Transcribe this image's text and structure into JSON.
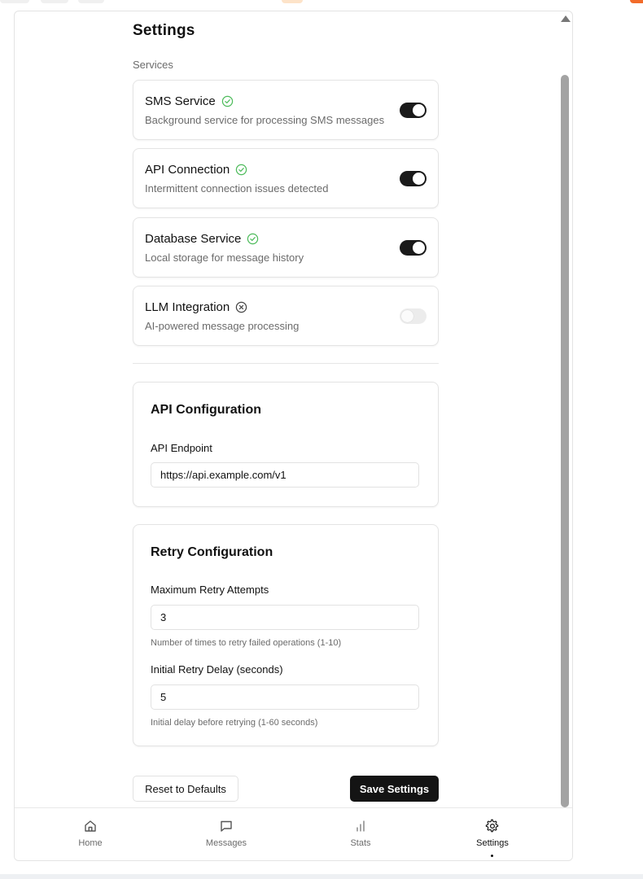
{
  "page": {
    "title": "Settings"
  },
  "services": {
    "label": "Services",
    "items": [
      {
        "name": "SMS Service",
        "description": "Background service for processing SMS messages",
        "status": "ok",
        "enabled": true
      },
      {
        "name": "API Connection",
        "description": "Intermittent connection issues detected",
        "status": "ok",
        "enabled": true
      },
      {
        "name": "Database Service",
        "description": "Local storage for message history",
        "status": "ok",
        "enabled": true
      },
      {
        "name": "LLM Integration",
        "description": "AI-powered message processing",
        "status": "error",
        "enabled": false
      }
    ]
  },
  "api_config": {
    "title": "API Configuration",
    "endpoint_label": "API Endpoint",
    "endpoint_value": "https://api.example.com/v1"
  },
  "retry_config": {
    "title": "Retry Configuration",
    "max_label": "Maximum Retry Attempts",
    "max_value": "3",
    "max_help": "Number of times to retry failed operations (1-10)",
    "delay_label": "Initial Retry Delay (seconds)",
    "delay_value": "5",
    "delay_help": "Initial delay before retrying (1-60 seconds)"
  },
  "actions": {
    "reset_label": "Reset to Defaults",
    "save_label": "Save Settings"
  },
  "nav": {
    "items": [
      {
        "label": "Home",
        "icon": "home-icon"
      },
      {
        "label": "Messages",
        "icon": "message-icon"
      },
      {
        "label": "Stats",
        "icon": "stats-icon"
      },
      {
        "label": "Settings",
        "icon": "gear-icon",
        "active": true
      }
    ]
  },
  "colors": {
    "ok": "#4cbb5a",
    "error": "#444444",
    "toggle_on": "#1a1a1a",
    "toggle_off": "#ececec",
    "primary_button": "#141414",
    "accent": "#f26b2a"
  }
}
